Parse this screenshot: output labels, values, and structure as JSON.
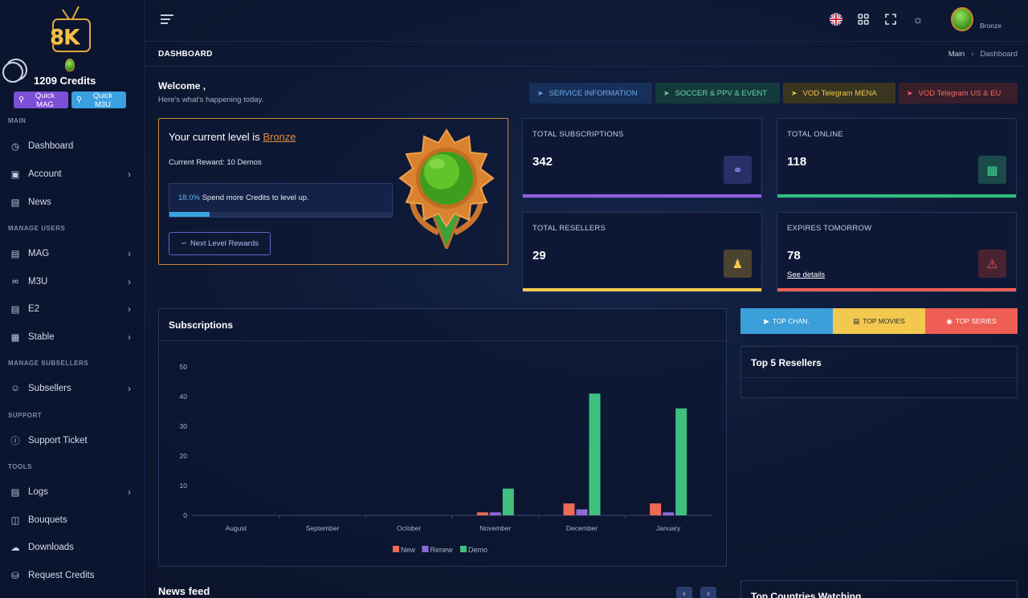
{
  "sidebar": {
    "logo_text": "8K",
    "credits": "1209 Credits",
    "quick_mag": "Quick MAG",
    "quick_m3u": "Quick M3U",
    "sections": {
      "main": "MAIN",
      "manage_users": "MANAGE USERS",
      "manage_subsellers": "MANAGE SUBSELLERS",
      "support": "SUPPORT",
      "tools": "TOOLS"
    },
    "items": {
      "dashboard": "Dashboard",
      "account": "Account",
      "news": "News",
      "mag": "MAG",
      "m3u": "M3U",
      "e2": "E2",
      "stable": "Stable",
      "subsellers": "Subsellers",
      "support_ticket": "Support Ticket",
      "logs": "Logs",
      "bouquets": "Bouquets",
      "downloads": "Downloads",
      "request_credits": "Request Credits"
    }
  },
  "header": {
    "rank": "Bronze"
  },
  "breadcrumb": {
    "title": "DASHBOARD",
    "main": "Main",
    "current": "Dashboard"
  },
  "welcome": {
    "title": "Welcome ,",
    "subtitle": "Here's what's happening today."
  },
  "pills": [
    {
      "label": "SERVICE INFORMATION",
      "color": "#6fa8e6",
      "bg": "#16305a"
    },
    {
      "label": "SOCCER & PPV & EVENT",
      "color": "#6fd6a8",
      "bg": "#123a3b"
    },
    {
      "label": "VOD Telegram MENA",
      "color": "#f2c94e",
      "bg": "#3a3520"
    },
    {
      "label": "VOD Telegram US & EU",
      "color": "#ee6a60",
      "bg": "#3a1f2b"
    }
  ],
  "level": {
    "title_prefix": "Your current level is ",
    "level_name": "Bronze",
    "reward": "Current Reward: 10 Demos",
    "percent_text": "18.0%",
    "percent_value": 18.0,
    "progress_text": " Spend more Credits to level up.",
    "next_button": "Next Level Rewards"
  },
  "stats": {
    "subscriptions": {
      "label": "TOTAL SUBSCRIPTIONS",
      "value": "342",
      "color": "#8e5fe0"
    },
    "online": {
      "label": "TOTAL ONLINE",
      "value": "118",
      "color": "#2fbf7a"
    },
    "resellers": {
      "label": "TOTAL RESELLERS",
      "value": "29",
      "color": "#f2c94e"
    },
    "expires": {
      "label": "EXPIRES TOMORROW",
      "value": "78",
      "link": "See details",
      "color": "#ee5e55"
    }
  },
  "chart_card_title": "Subscriptions",
  "chart_data": {
    "type": "bar",
    "categories": [
      "August",
      "September",
      "October",
      "November",
      "December",
      "January"
    ],
    "series": [
      {
        "name": "New",
        "color": "#ee6a55",
        "values": [
          0,
          0,
          0,
          1,
          4,
          4
        ]
      },
      {
        "name": "Renew",
        "color": "#8e6ad8",
        "values": [
          0,
          0,
          0,
          1,
          2,
          1
        ]
      },
      {
        "name": "Demo",
        "color": "#3fc07f",
        "values": [
          0,
          0,
          0,
          9,
          41,
          36
        ]
      }
    ],
    "yticks": [
      "50",
      "40",
      "30",
      "20",
      "10",
      "0"
    ],
    "ylim": [
      0,
      50
    ]
  },
  "tabs": {
    "channels": "TOP CHAN.",
    "movies": "TOP MOVIES",
    "series": "TOP SERIES"
  },
  "top_resellers_title": "Top 5 Resellers",
  "top_countries_title": "Top Countries Watching",
  "news_feed_title": "News feed"
}
